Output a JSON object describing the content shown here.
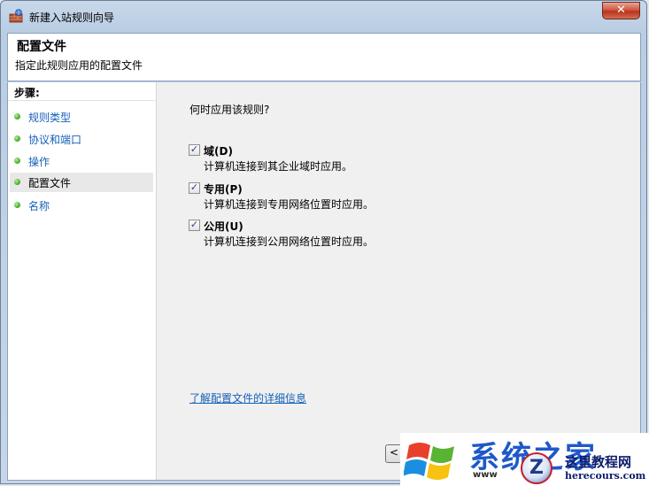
{
  "window": {
    "title": "新建入站规则向导",
    "close_label": "✕"
  },
  "header": {
    "title": "配置文件",
    "subtitle": "指定此规则应用的配置文件"
  },
  "steps": {
    "heading": "步骤:",
    "items": [
      {
        "label": "规则类型",
        "active": false
      },
      {
        "label": "协议和端口",
        "active": false
      },
      {
        "label": "操作",
        "active": false
      },
      {
        "label": "配置文件",
        "active": true
      },
      {
        "label": "名称",
        "active": false
      }
    ]
  },
  "main": {
    "question": "何时应用该规则?",
    "options": [
      {
        "label": "域(D)",
        "description": "计算机连接到其企业域时应用。",
        "checked": true
      },
      {
        "label": "专用(P)",
        "description": "计算机连接到专用网络位置时应用。",
        "checked": true
      },
      {
        "label": "公用(U)",
        "description": "计算机连接到公用网络位置时应用。",
        "checked": true
      }
    ],
    "learn_more_link": "了解配置文件的详细信息",
    "back_button": "<"
  },
  "watermark": {
    "big_text": "系统之家",
    "badge": "Z",
    "site_name": "这里教程网",
    "site_url": "herecours.com",
    "url2": "www"
  }
}
